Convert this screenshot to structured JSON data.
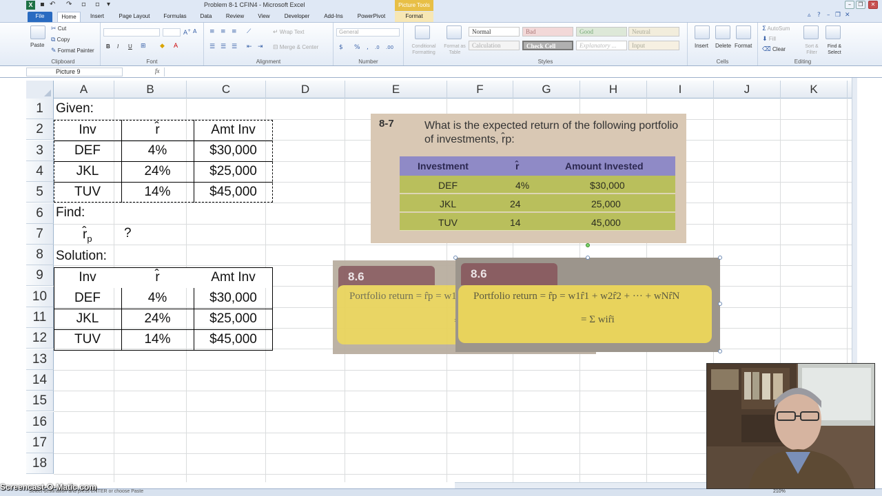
{
  "window": {
    "title": "Problem 8-1 CFIN4 - Microsoft Excel",
    "contextual_tab_group": "Picture Tools",
    "app_icon": "excel-logo-icon",
    "controls": [
      "minimize-icon",
      "restore-icon",
      "close-icon"
    ]
  },
  "ribbon": {
    "tabs": [
      "File",
      "Home",
      "Insert",
      "Page Layout",
      "Formulas",
      "Data",
      "Review",
      "View",
      "Developer",
      "Add-Ins",
      "PowerPivot",
      "Format"
    ],
    "active_tab": "Home",
    "clipboard": {
      "label": "Clipboard",
      "paste": "Paste",
      "cut": "Cut",
      "copy": "Copy",
      "format_painter": "Format Painter"
    },
    "font": {
      "label": "Font"
    },
    "alignment": {
      "label": "Alignment",
      "wrap_text": "Wrap Text",
      "merge_center": "Merge & Center"
    },
    "number": {
      "label": "Number",
      "format": "General"
    },
    "styles": {
      "label": "Styles",
      "conditional_formatting": "Conditional Formatting",
      "format_as_table": "Format as Table",
      "cells": [
        "Normal",
        "Bad",
        "Good",
        "Neutral",
        "Calculation",
        "Check Cell",
        "Explanatory ...",
        "Input"
      ]
    },
    "cells": {
      "label": "Cells",
      "insert": "Insert",
      "delete": "Delete",
      "format": "Format"
    },
    "editing": {
      "label": "Editing",
      "autosum": "AutoSum",
      "fill": "Fill",
      "clear": "Clear",
      "sort_filter": "Sort & Filter",
      "find_select": "Find & Select"
    }
  },
  "formula_bar": {
    "name_box": "Picture 9",
    "fx_label": "fx",
    "content": ""
  },
  "sheet": {
    "columns": [
      "A",
      "B",
      "C",
      "D",
      "E",
      "F",
      "G",
      "H",
      "I",
      "J",
      "K"
    ],
    "rows": [
      "1",
      "2",
      "3",
      "4",
      "5",
      "6",
      "7",
      "8",
      "9",
      "10",
      "11",
      "12",
      "13",
      "14",
      "15",
      "16",
      "17",
      "18"
    ],
    "given_label": "Given:",
    "find_label": "Find:",
    "solution_label": "Solution:",
    "header": {
      "inv": "Inv",
      "r": "r̂",
      "amt": "Amt Inv"
    },
    "given_rows": [
      {
        "inv": "DEF",
        "r": "4%",
        "amt": "$30,000"
      },
      {
        "inv": "JKL",
        "r": "24%",
        "amt": "$25,000"
      },
      {
        "inv": "TUV",
        "r": "14%",
        "amt": "$45,000"
      }
    ],
    "find_symbol": "r̂",
    "find_subscript": "p",
    "find_value": "?",
    "solution_rows": [
      {
        "inv": "DEF",
        "r": "4%",
        "amt": "$30,000"
      },
      {
        "inv": "JKL",
        "r": "24%",
        "amt": "$25,000"
      },
      {
        "inv": "TUV",
        "r": "14%",
        "amt": "$45,000"
      }
    ]
  },
  "picture_problem": {
    "number": "8-7",
    "question": "What is the expected return of the following portfolio of investments, r̂p:",
    "headers": [
      "Investment",
      "r̂",
      "Amount Invested"
    ],
    "rows": [
      {
        "inv": "DEF",
        "r": "4%",
        "amt": "$30,000"
      },
      {
        "inv": "JKL",
        "r": "24",
        "amt": "25,000"
      },
      {
        "inv": "TUV",
        "r": "14",
        "amt": "45,000"
      }
    ]
  },
  "picture_formula": {
    "number": "8.6",
    "line1": "Portfolio return = r̂p = w1r̂1 + w2r̂2 + ··· + wNr̂N",
    "line2": "= Σ wir̂i"
  },
  "status": {
    "message": "Select destination and press ENTER or choose Paste",
    "zoom": "210%"
  },
  "watermark": "Screencast-O-Matic.com",
  "colors": {
    "ribbon_bg": "#dfe8f5",
    "file_tab": "#2a6bc1",
    "picture_tools": "#e8bf46",
    "header_band": "#8f8ac6",
    "row_band": "#b9bf5c",
    "formula_band": "#e8d35c"
  }
}
